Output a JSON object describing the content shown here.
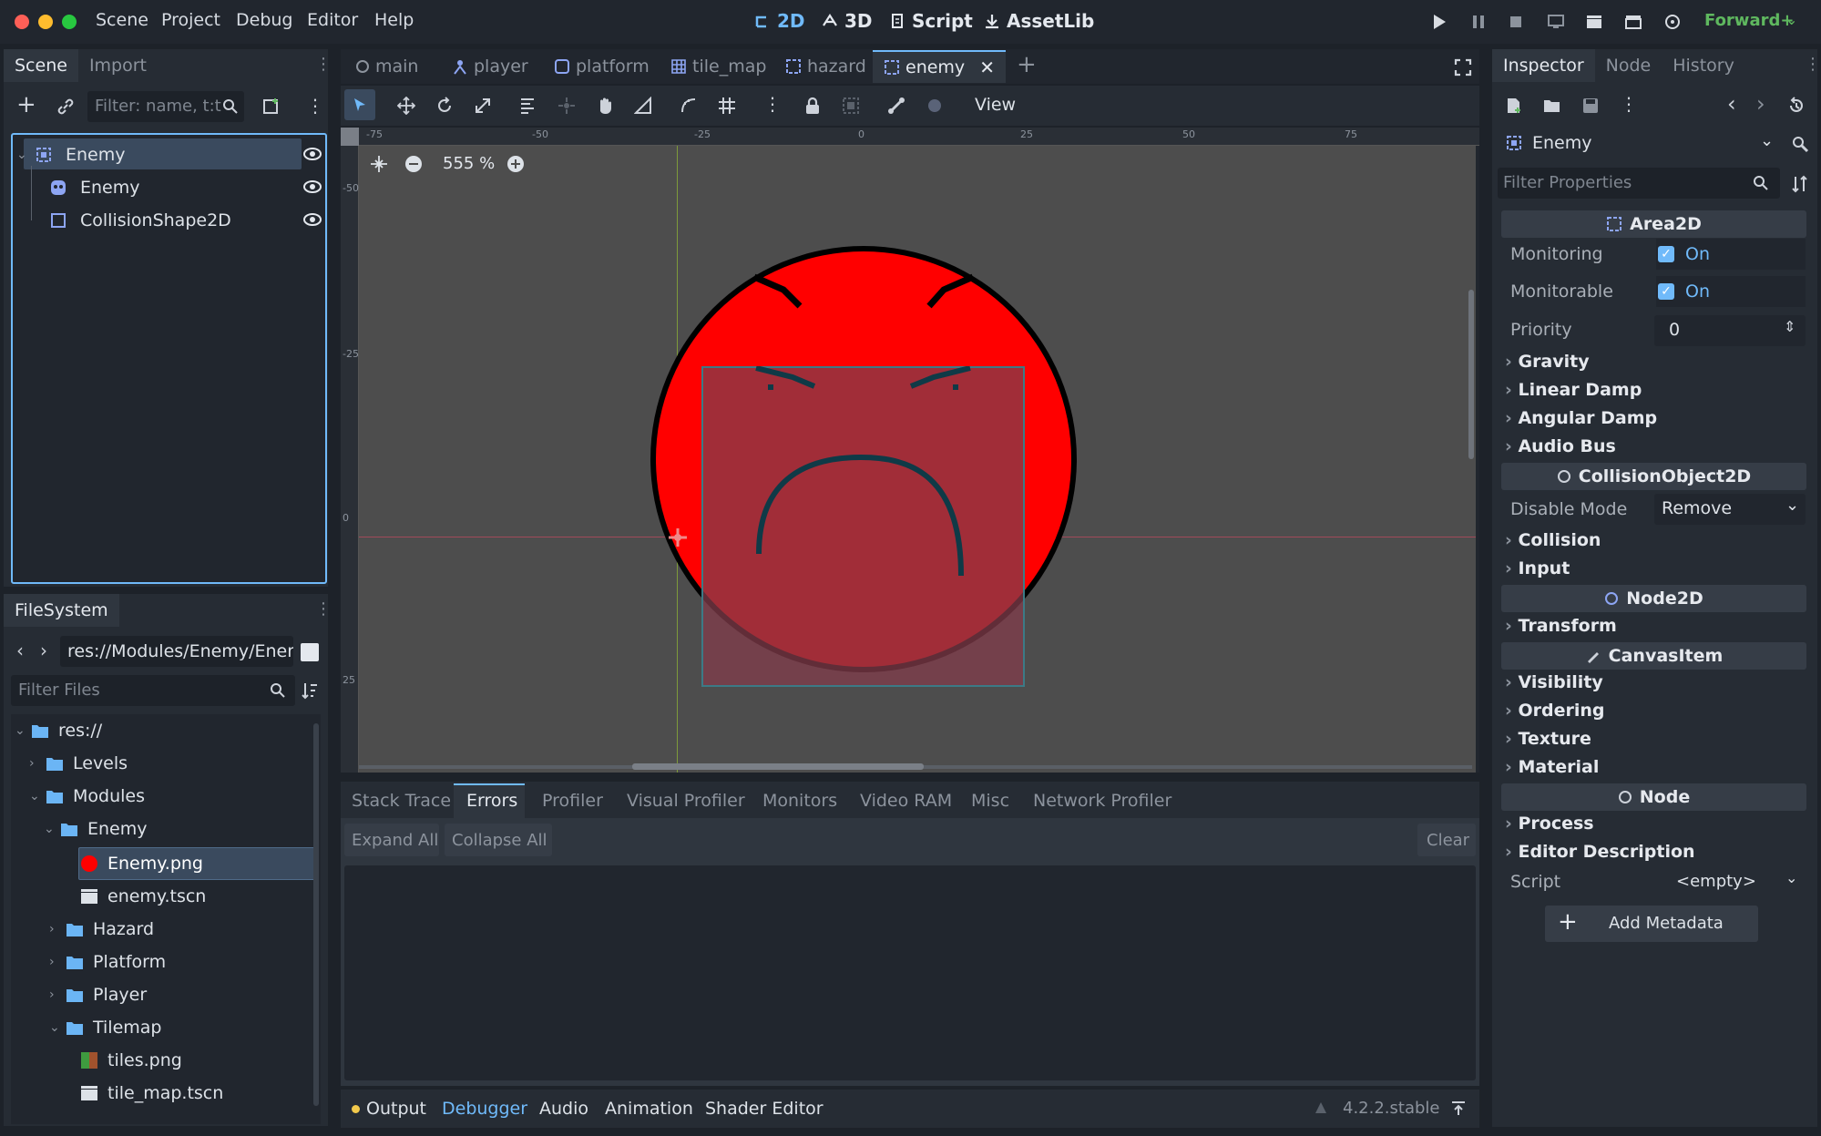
{
  "menu": {
    "items": [
      "Scene",
      "Project",
      "Debug",
      "Editor",
      "Help"
    ]
  },
  "modes": {
    "two_d": "2D",
    "three_d": "3D",
    "script": "Script",
    "assetlib": "AssetLib"
  },
  "renderer": "Forward+",
  "scene_panel": {
    "tabs": [
      "Scene",
      "Import"
    ],
    "filter_placeholder": "Filter: name, t:t",
    "tree": [
      {
        "label": "Enemy",
        "icon": "area2d-icon"
      },
      {
        "label": "Enemy",
        "icon": "sprite-icon"
      },
      {
        "label": "CollisionShape2D",
        "icon": "collision-shape-icon"
      }
    ]
  },
  "filesystem": {
    "tab": "FileSystem",
    "path": "res://Modules/Enemy/Enem",
    "filter_placeholder": "Filter Files",
    "items": [
      "res://",
      "Levels",
      "Modules",
      "Enemy",
      "Enemy.png",
      "enemy.tscn",
      "Hazard",
      "Platform",
      "Player",
      "Tilemap",
      "tiles.png",
      "tile_map.tscn"
    ]
  },
  "scene_tabs": [
    "main",
    "player",
    "platform",
    "tile_map",
    "hazard",
    "enemy"
  ],
  "toolbar": {
    "view_label": "View"
  },
  "viewport": {
    "zoom": "555 %",
    "ruler_top": [
      "-75",
      "-50",
      "-25",
      "0",
      "25",
      "50",
      "75"
    ],
    "ruler_left": [
      "-50",
      "-25",
      "0",
      "25"
    ]
  },
  "debugger": {
    "tabs": [
      "Stack Trace",
      "Errors",
      "Profiler",
      "Visual Profiler",
      "Monitors",
      "Video RAM",
      "Misc",
      "Network Profiler"
    ],
    "expand_all": "Expand All",
    "collapse_all": "Collapse All",
    "clear": "Clear"
  },
  "bottom_bar": {
    "tabs": [
      "Output",
      "Debugger",
      "Audio",
      "Animation",
      "Shader Editor"
    ],
    "version": "4.2.2.stable"
  },
  "inspector": {
    "tabs": [
      "Inspector",
      "Node",
      "History"
    ],
    "object": "Enemy",
    "filter_placeholder": "Filter Properties",
    "area2d": "Area2D",
    "monitoring_label": "Monitoring",
    "monitoring_value": "On",
    "monitorable_label": "Monitorable",
    "monitorable_value": "On",
    "priority_label": "Priority",
    "priority_value": "0",
    "groups1": [
      "Gravity",
      "Linear Damp",
      "Angular Damp",
      "Audio Bus"
    ],
    "collision_object": "CollisionObject2D",
    "disable_mode_label": "Disable Mode",
    "disable_mode_value": "Remove",
    "groups2": [
      "Collision",
      "Input"
    ],
    "node2d": "Node2D",
    "groups3": [
      "Transform"
    ],
    "canvas_item": "CanvasItem",
    "groups4": [
      "Visibility",
      "Ordering",
      "Texture",
      "Material"
    ],
    "node": "Node",
    "groups5": [
      "Process",
      "Editor Description"
    ],
    "script_label": "Script",
    "script_value": "<empty>",
    "add_metadata": "Add Metadata"
  },
  "colors": {
    "accent": "#70bafa",
    "enemy_red": "#ff0000",
    "collision": "#8a3a46"
  }
}
